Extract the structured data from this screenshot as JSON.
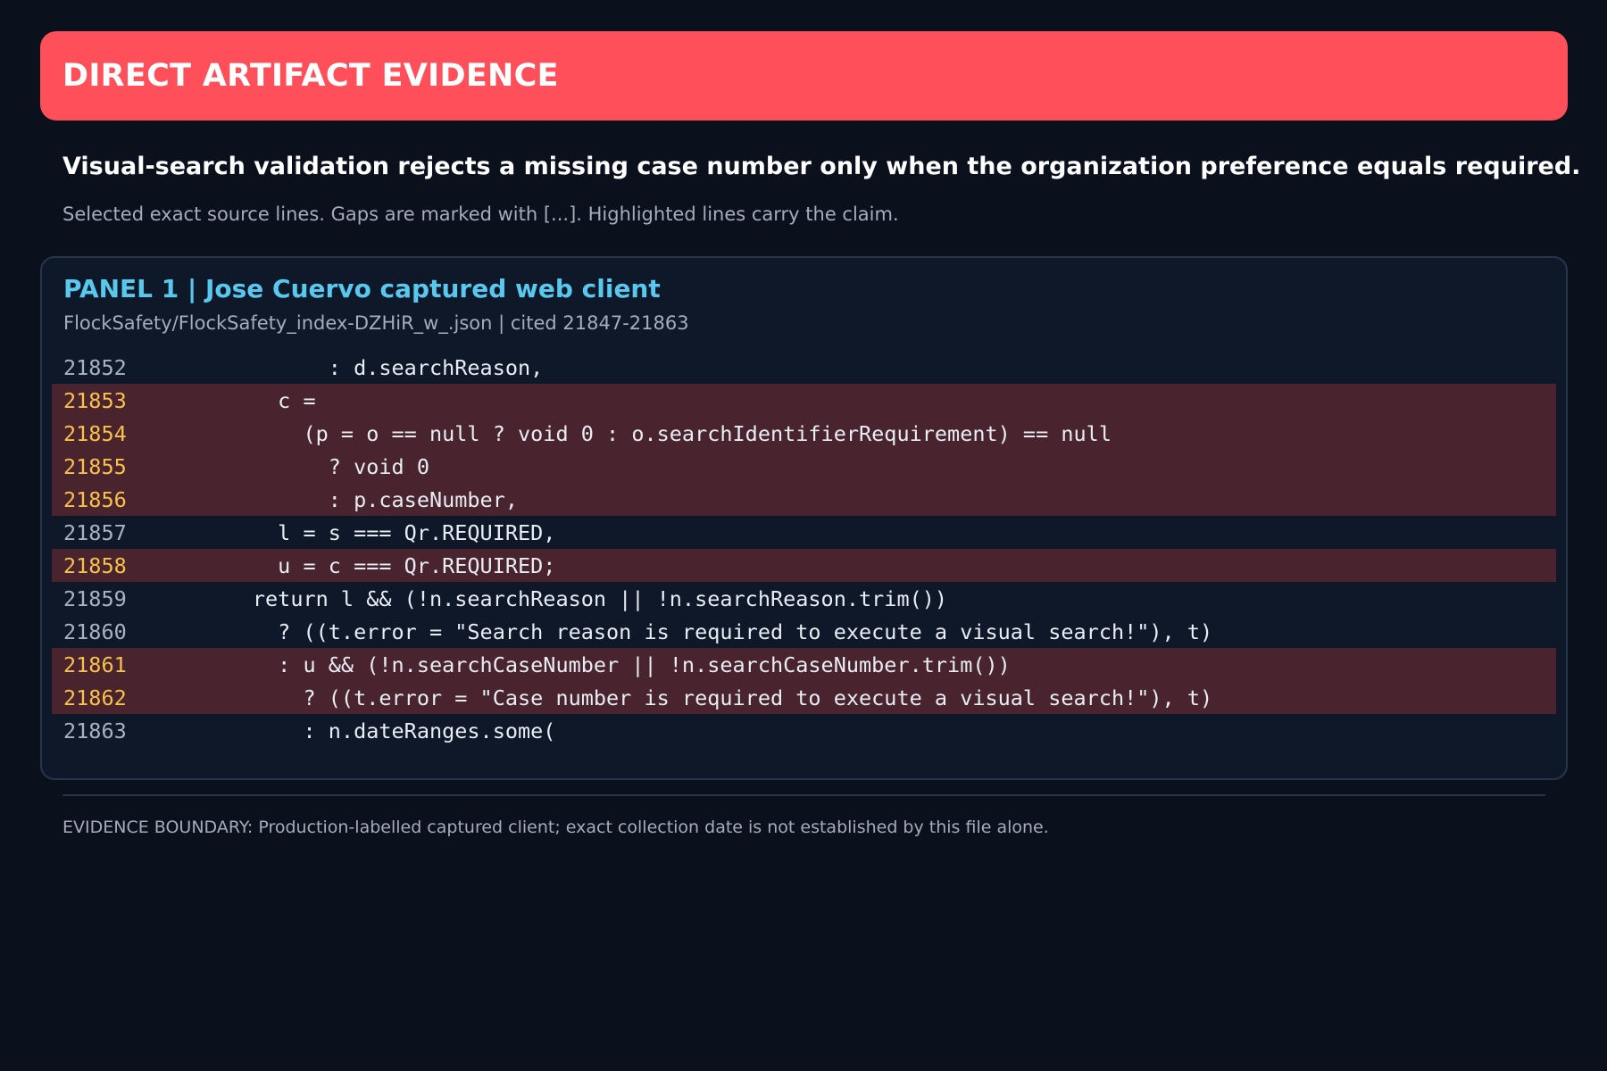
{
  "banner": {
    "title": "DIRECT ARTIFACT EVIDENCE"
  },
  "claim": "Visual-search validation rejects a missing case number only when the organization preference equals required.",
  "subnote": "Selected exact source lines. Gaps are marked with [...]. Highlighted lines carry the claim.",
  "panel": {
    "title": "PANEL 1  |  Jose Cuervo captured web client",
    "source": "FlockSafety/FlockSafety_index-DZHiR_w_.json  |  cited 21847-21863",
    "lines": [
      {
        "number": "21852",
        "text": "            : d.searchReason,",
        "highlighted": false
      },
      {
        "number": "21853",
        "text": "        c =",
        "highlighted": true
      },
      {
        "number": "21854",
        "text": "          (p = o == null ? void 0 : o.searchIdentifierRequirement) == null",
        "highlighted": true
      },
      {
        "number": "21855",
        "text": "            ? void 0",
        "highlighted": true
      },
      {
        "number": "21856",
        "text": "            : p.caseNumber,",
        "highlighted": true
      },
      {
        "number": "21857",
        "text": "        l = s === Qr.REQUIRED,",
        "highlighted": false
      },
      {
        "number": "21858",
        "text": "        u = c === Qr.REQUIRED;",
        "highlighted": true
      },
      {
        "number": "21859",
        "text": "      return l && (!n.searchReason || !n.searchReason.trim())",
        "highlighted": false
      },
      {
        "number": "21860",
        "text": "        ? ((t.error = \"Search reason is required to execute a visual search!\"), t)",
        "highlighted": false
      },
      {
        "number": "21861",
        "text": "        : u && (!n.searchCaseNumber || !n.searchCaseNumber.trim())",
        "highlighted": true
      },
      {
        "number": "21862",
        "text": "          ? ((t.error = \"Case number is required to execute a visual search!\"), t)",
        "highlighted": true
      },
      {
        "number": "21863",
        "text": "          : n.dateRanges.some(",
        "highlighted": false
      }
    ]
  },
  "footer": {
    "boundary": "EVIDENCE BOUNDARY: Production-labelled captured client; exact collection date is not established by this file alone."
  },
  "colors": {
    "banner": "#ff4f5a",
    "panel_title": "#58c8ef",
    "highlight_bg": "#49242e",
    "highlight_number": "#f7c14b",
    "background": "#0a101c"
  }
}
